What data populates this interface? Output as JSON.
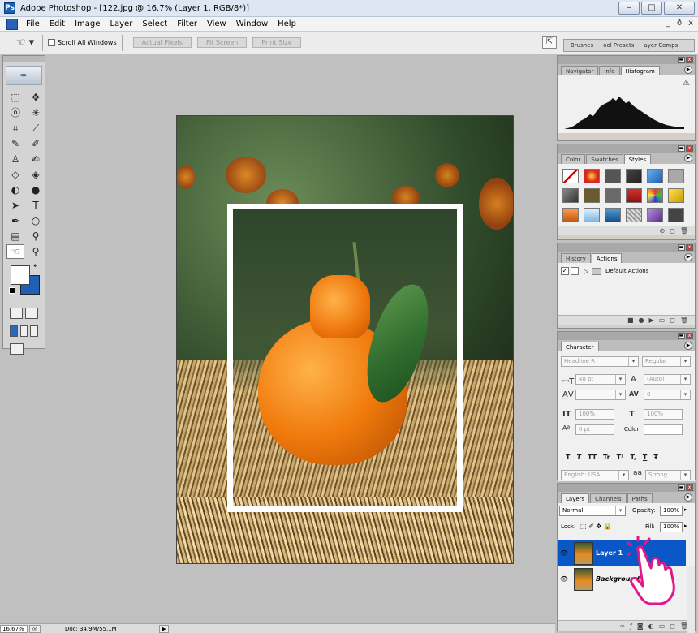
{
  "window": {
    "title": "Adobe Photoshop - [122.jpg @ 16.7% (Layer 1, RGB/8*)]",
    "minimize": "–",
    "maximize": "□",
    "close": "✕"
  },
  "menu": {
    "items": [
      "File",
      "Edit",
      "Image",
      "Layer",
      "Select",
      "Filter",
      "View",
      "Window",
      "Help"
    ],
    "doc_min": "_",
    "doc_restore": "ð",
    "doc_close": "x"
  },
  "options": {
    "scroll_all_windows": "Scroll All Windows",
    "actual_pixels": "Actual Pixels",
    "fit_screen": "Fit Screen",
    "print_size": "Print Size",
    "well_tabs": [
      "Brushes",
      "ool Presets",
      "ayer Comps"
    ]
  },
  "status": {
    "zoom": "16.67%",
    "doc": "Doc: 34.9M/55.1M"
  },
  "navigator": {
    "tabs": [
      "Navigator",
      "Info",
      "Histogram"
    ],
    "active": 2
  },
  "styles_panel": {
    "tabs": [
      "Color",
      "Swatches",
      "Styles"
    ],
    "active": 2
  },
  "actions_panel": {
    "tabs": [
      "History",
      "Actions"
    ],
    "active": 1,
    "set_name": "Default Actions"
  },
  "character": {
    "tab": "Character",
    "font_family": "Headline R",
    "font_style": "Regular",
    "size": "48 pt",
    "leading": "(Auto)",
    "tracking": "0",
    "vscale": "100%",
    "hscale": "100%",
    "baseline": "0 pt",
    "color_label": "Color:",
    "language": "English: USA",
    "aa_label": "a",
    "antialias": "Strong",
    "type_styles": [
      "T",
      "T",
      "TT",
      "Tr",
      "T¹",
      "T,",
      "T",
      "Ŧ"
    ]
  },
  "layers": {
    "tabs": [
      "Layers",
      "Channels",
      "Paths"
    ],
    "active": 0,
    "blend_mode": "Normal",
    "opacity_label": "Opacity:",
    "opacity": "100%",
    "lock_label": "Lock:",
    "fill_label": "Fill:",
    "fill": "100%",
    "rows": [
      {
        "name": "Layer 1",
        "selected": true
      },
      {
        "name": "Background",
        "selected": false
      }
    ]
  },
  "colors": {
    "foreground": "#ffffff",
    "background": "#1f5fb6",
    "selection": "#0a58c8"
  }
}
